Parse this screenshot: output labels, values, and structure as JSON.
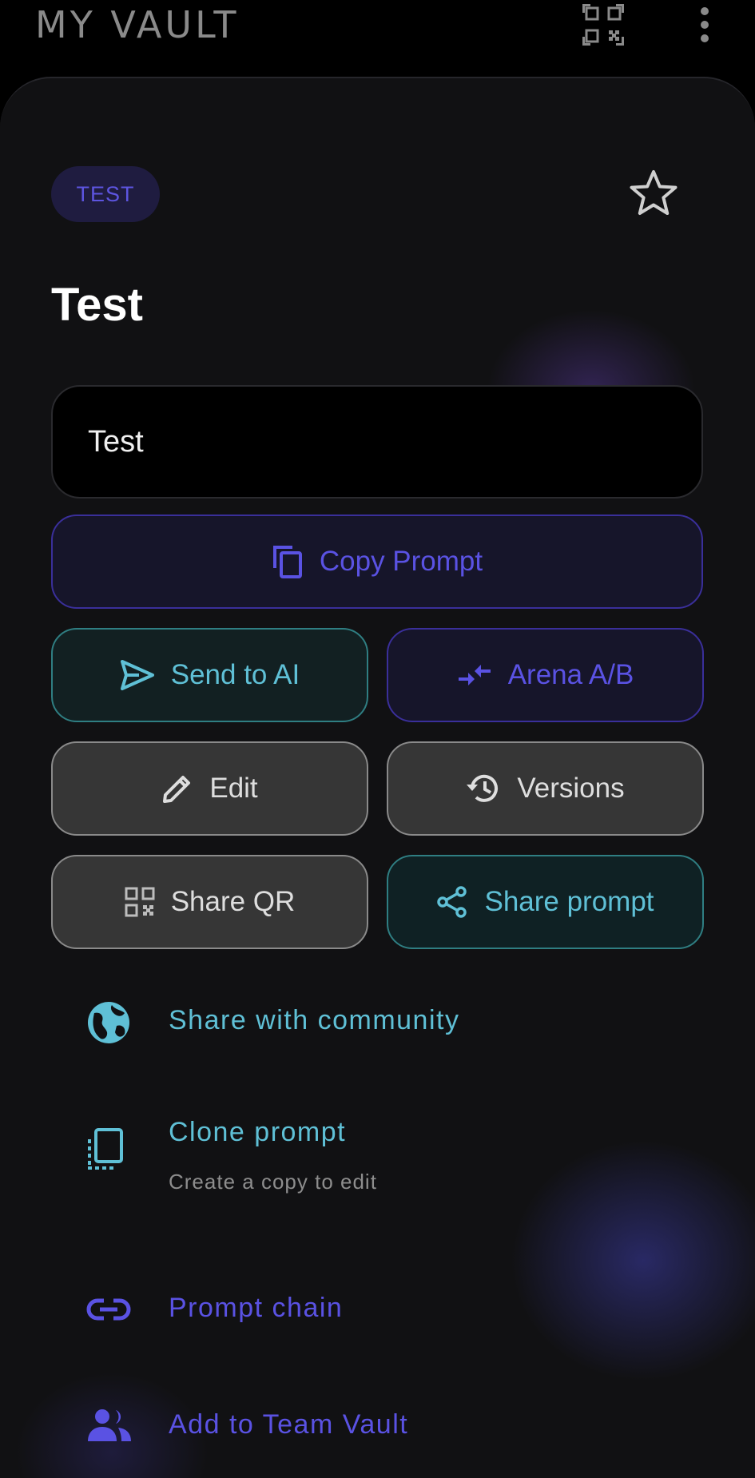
{
  "header": {
    "title": "MY VAULT",
    "icons": [
      "qr-code-icon",
      "more-vert-icon"
    ]
  },
  "prompt": {
    "tag": "TEST",
    "title": "Test",
    "content": "Test",
    "favorite": false
  },
  "actions": {
    "copy": "Copy Prompt",
    "send": "Send to AI",
    "arena": "Arena A/B",
    "edit": "Edit",
    "versions": "Versions",
    "share_qr": "Share QR",
    "share_prompt": "Share prompt"
  },
  "options": [
    {
      "label": "Share with community",
      "icon": "globe-icon"
    },
    {
      "label": "Clone prompt",
      "sub": "Create a copy to edit",
      "icon": "clone-icon"
    },
    {
      "label": "Prompt chain",
      "icon": "link-icon"
    },
    {
      "label": "Add to Team Vault",
      "icon": "group-icon"
    }
  ],
  "colors": {
    "background": "#000000",
    "sheet": "#111113",
    "accent_indigo": "#5a52e3",
    "accent_teal": "#5fc0d6",
    "neutral_button": "#363636"
  }
}
